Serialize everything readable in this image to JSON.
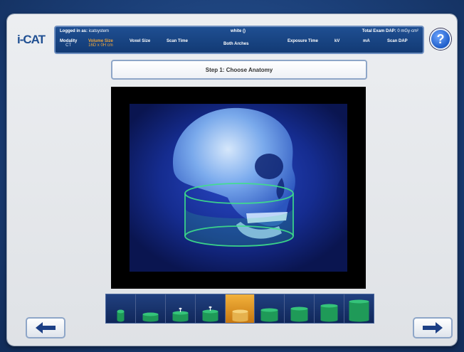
{
  "app": {
    "logo_text": "i-CAT"
  },
  "header": {
    "logged_in_label": "Logged in as:",
    "logged_in_user": "icatsystem",
    "patient": "white ()",
    "dap_label": "Total Exam DAP:",
    "dap_value": "0 mGy·cm²",
    "modality_label": "Modality",
    "modality_value": "CT",
    "volume_size_label": "Volume Size",
    "volume_size_value": "16D x 0H cm",
    "voxel_size_label": "Voxel Size",
    "scan_time_label": "Scan Time",
    "arches_value": "Both Arches",
    "exposure_time_label": "Exposure Time",
    "kv_label": "kV",
    "ma_label": "mA",
    "scan_dap_label": "Scan DAP"
  },
  "help": {
    "label": "?"
  },
  "step": {
    "label": "Step 1: Choose Anatomy"
  },
  "thumbnails": {
    "count": 9,
    "selected_index": 4
  },
  "colors": {
    "accent": "#f0a63a",
    "header_blue": "#1f4f92",
    "selection_orange": "#e89a22",
    "cylinder_green": "#3ee08a"
  }
}
